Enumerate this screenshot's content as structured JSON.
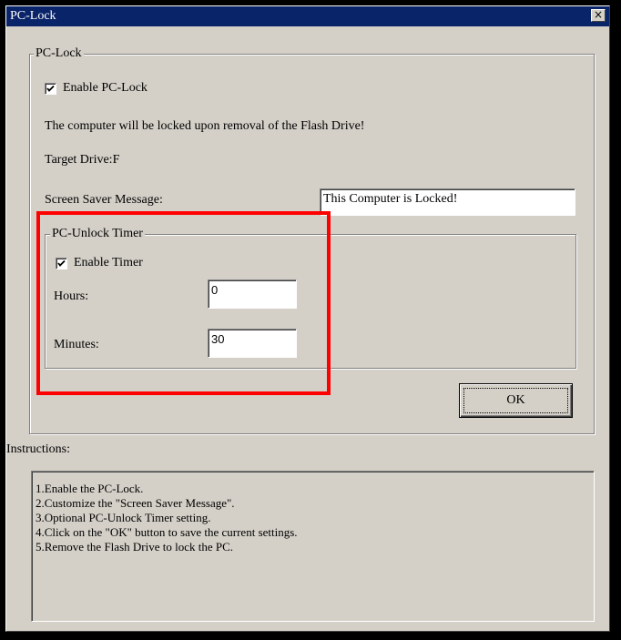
{
  "window": {
    "title": "PC-Lock",
    "close_label": "×"
  },
  "pclock_group": {
    "legend": "PC-Lock",
    "enable_checkbox": {
      "label": "Enable PC-Lock",
      "checked": true
    },
    "info_text": "The computer will be locked upon removal of the Flash Drive!",
    "target_drive": "Target Drive:F",
    "screen_saver_label": "Screen Saver Message:",
    "screen_saver_value": "This Computer is Locked!"
  },
  "timer_group": {
    "legend": "PC-Unlock Timer",
    "enable_checkbox": {
      "label": "Enable Timer",
      "checked": true
    },
    "hours_label": "Hours:",
    "hours_value": "0",
    "minutes_label": "Minutes:",
    "minutes_value": "30"
  },
  "ok_button": {
    "label": "OK"
  },
  "instructions": {
    "label": "Instructions:",
    "lines": [
      "1.Enable the PC-Lock.",
      "2.Customize the \"Screen Saver Message\".",
      "3.Optional PC-Unlock Timer setting.",
      "4.Click on the \"OK\" button to save the current settings.",
      "5.Remove the Flash Drive to lock the PC."
    ]
  },
  "annotation": {
    "color": "#ff0000"
  },
  "colors": {
    "face": "#d4d0c8",
    "titlebar": "#0a246a"
  }
}
